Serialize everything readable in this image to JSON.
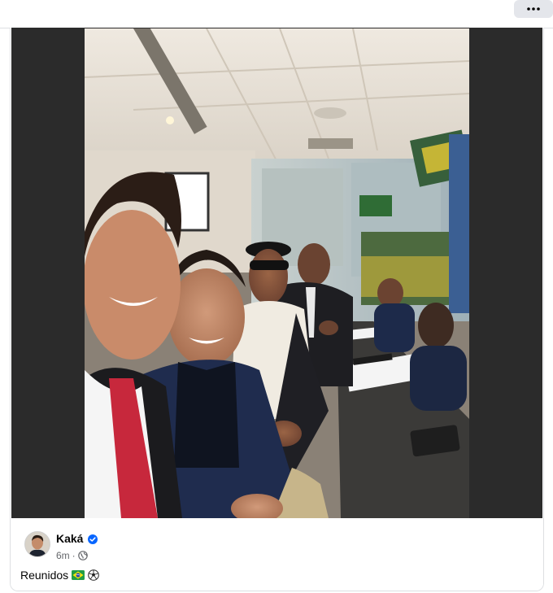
{
  "toolbar": {
    "more_icon": "more-horizontal-icon"
  },
  "post": {
    "author": "Kaká",
    "verified_icon": "verified-badge-icon",
    "timestamp": "6m",
    "separator": "·",
    "audience_icon": "globe-icon",
    "caption_text": "Reunidos",
    "caption_emojis": [
      "brazil-flag-icon",
      "soccer-ball-icon"
    ],
    "media": {
      "subject": "photo"
    }
  },
  "colors": {
    "accent": "#0866ff",
    "text_primary": "#050505",
    "text_secondary": "#65676b",
    "card_border": "#dddfe2",
    "media_background": "#2b2b2b"
  }
}
